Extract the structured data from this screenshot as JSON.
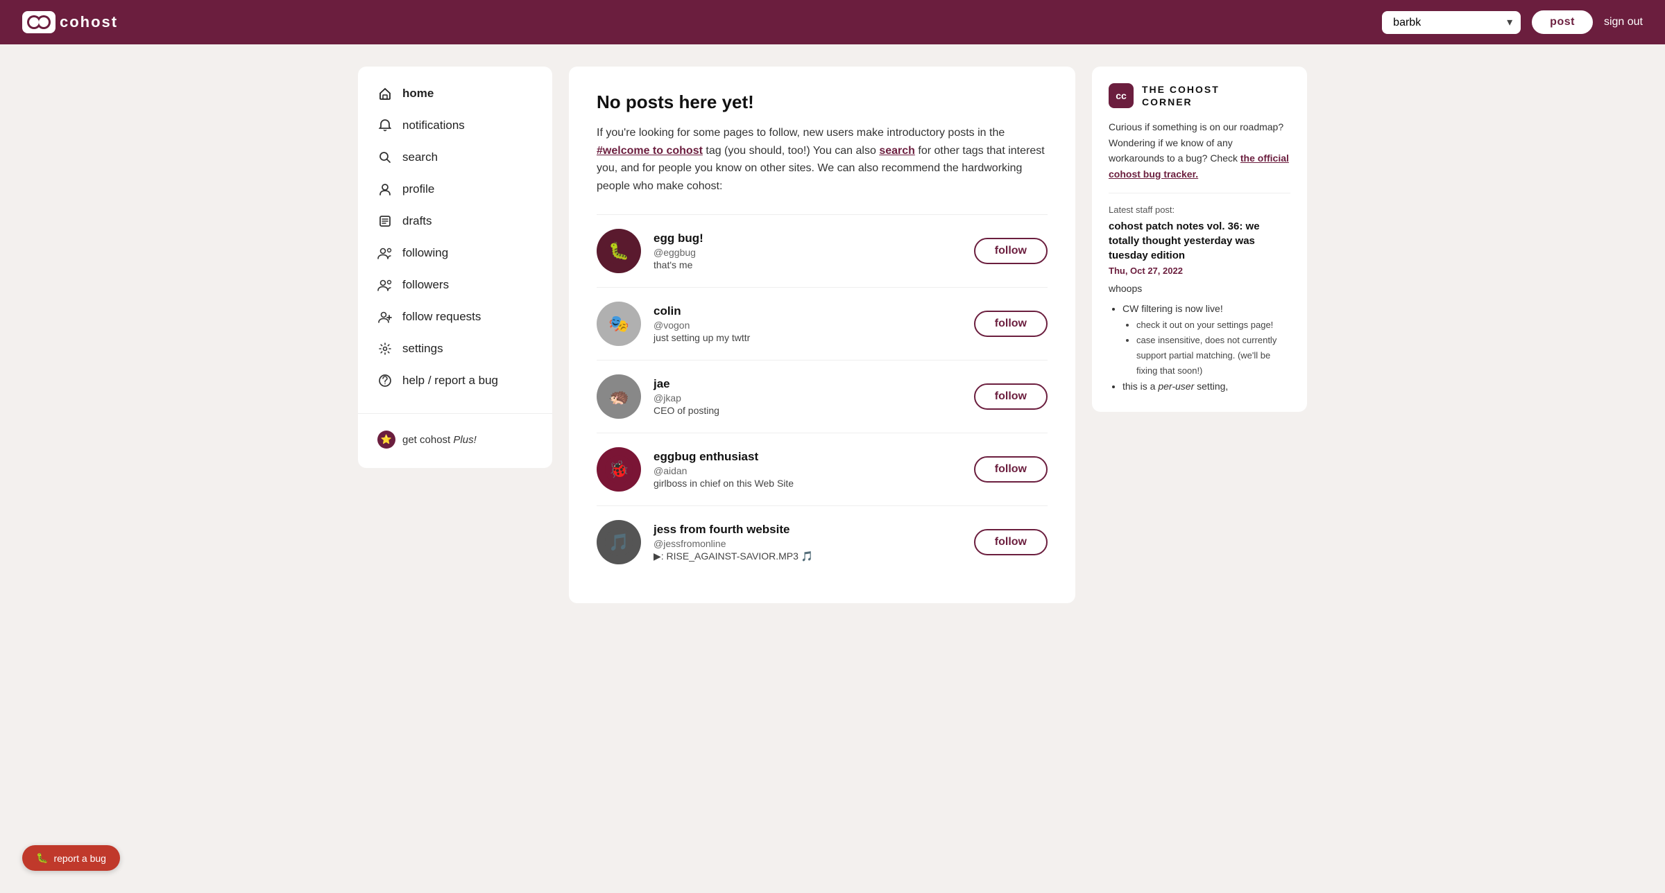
{
  "header": {
    "logo_text": "cohost",
    "account_value": "barbk",
    "post_label": "post",
    "signout_label": "sign out"
  },
  "sidebar": {
    "items": [
      {
        "id": "home",
        "label": "home",
        "icon": "🏠",
        "active": true
      },
      {
        "id": "notifications",
        "label": "notifications",
        "icon": "🔔",
        "active": false
      },
      {
        "id": "search",
        "label": "search",
        "icon": "🔍",
        "active": false
      },
      {
        "id": "profile",
        "label": "profile",
        "icon": "👤",
        "active": false
      },
      {
        "id": "drafts",
        "label": "drafts",
        "icon": "📄",
        "active": false
      },
      {
        "id": "following",
        "label": "following",
        "icon": "👥",
        "active": false
      },
      {
        "id": "followers",
        "label": "followers",
        "icon": "👥",
        "active": false
      },
      {
        "id": "follow-requests",
        "label": "follow requests",
        "icon": "➕",
        "active": false
      },
      {
        "id": "settings",
        "label": "settings",
        "icon": "⚙️",
        "active": false
      },
      {
        "id": "help",
        "label": "help / report a bug",
        "icon": "⭕",
        "active": false
      }
    ],
    "get_plus_label": "get cohost ",
    "get_plus_italic": "Plus!",
    "report_bug_label": "report a bug"
  },
  "main": {
    "no_posts_title": "No posts here yet!",
    "no_posts_desc_1": "If you're looking for some pages to follow, new users make introductory posts in the ",
    "no_posts_link1": "#welcome to cohost",
    "no_posts_desc_2": " tag (you should, too!) You can also ",
    "no_posts_link2": "search",
    "no_posts_desc_3": " for other tags that interest you, and for people you know on other sites. We can also recommend the hardworking people who make cohost:",
    "users": [
      {
        "id": "eggbug",
        "name": "egg bug!",
        "handle": "@eggbug",
        "bio": "that's me",
        "avatar_emoji": "🐛",
        "avatar_color": "#5a1a2e",
        "follow_label": "follow"
      },
      {
        "id": "colin",
        "name": "colin",
        "handle": "@vogon",
        "bio": "just setting up my twttr",
        "avatar_emoji": "🎭",
        "avatar_color": "#b0b0b0",
        "follow_label": "follow"
      },
      {
        "id": "jae",
        "name": "jae",
        "handle": "@jkap",
        "bio": "CEO of posting",
        "avatar_emoji": "🦔",
        "avatar_color": "#888",
        "follow_label": "follow"
      },
      {
        "id": "aidan",
        "name": "eggbug enthusiast",
        "handle": "@aidan",
        "bio": "girlboss in chief on this Web Site",
        "avatar_emoji": "🐞",
        "avatar_color": "#7a1535",
        "follow_label": "follow"
      },
      {
        "id": "jess",
        "name": "jess from fourth website",
        "handle": "@jessfromonline",
        "bio": "▶: RISE_AGAINST-SAVIOR.MP3 🎵",
        "avatar_emoji": "🎵",
        "avatar_color": "#555",
        "follow_label": "follow"
      }
    ]
  },
  "corner": {
    "logo_text": "cc",
    "title_line1": "THE COHOST",
    "title_line2": "CORNER",
    "desc": "Curious if something is on our roadmap? Wondering if we know of any workarounds to a bug? Check ",
    "link_text": "the official cohost bug tracker.",
    "latest_staff_label": "Latest staff post:",
    "post_title": "cohost patch notes vol. 36: we totally thought yesterday was tuesday edition",
    "post_date": "Thu, Oct 27, 2022",
    "post_intro": "whoops",
    "bullets": [
      "CW filtering is now live!",
      "check it out on your settings page!",
      "case insensitive, does not currently support partial matching. (we'll be fixing that soon!)",
      "this is a per-user setting,"
    ]
  }
}
